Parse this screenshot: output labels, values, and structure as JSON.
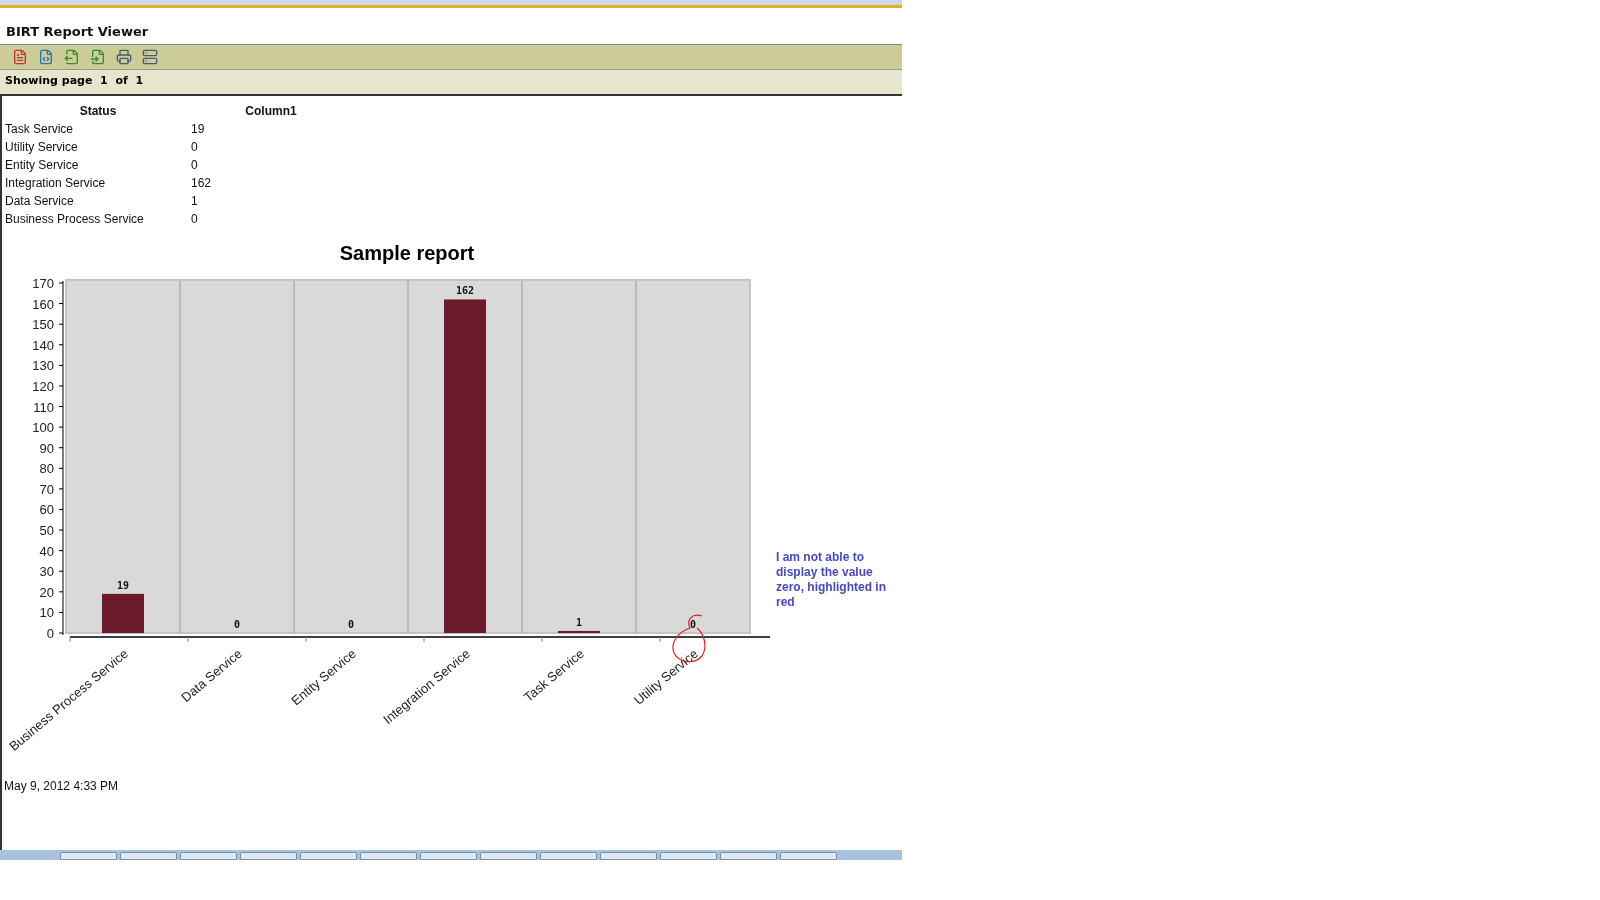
{
  "viewer": {
    "title": "BIRT Report Viewer",
    "page_info": "Showing page  1  of  1"
  },
  "table": {
    "columns": [
      "Status",
      "Column1"
    ],
    "rows": [
      [
        "Task Service",
        "19"
      ],
      [
        "Utility Service",
        "0"
      ],
      [
        "Entity Service",
        "0"
      ],
      [
        "Integration Service",
        "162"
      ],
      [
        "Data Service",
        "1"
      ],
      [
        "Business Process Service",
        "0"
      ]
    ]
  },
  "chart": {
    "chart_data": {
      "type": "bar",
      "title": "Sample report",
      "categories": [
        "Business Process Service",
        "Data Service",
        "Entity Service",
        "Integration Service",
        "Task Service",
        "Utility Service"
      ],
      "series": [
        {
          "color": "#6b1a2c",
          "values": [
            19,
            0,
            0,
            162,
            1,
            0
          ]
        }
      ],
      "ylim": [
        0,
        170
      ],
      "yticks": [
        0,
        10,
        20,
        30,
        40,
        50,
        60,
        70,
        80,
        90,
        100,
        110,
        120,
        130,
        140,
        150,
        160,
        170
      ],
      "data_labels": true
    }
  },
  "timestamp": "May 9, 2012 4:33 PM",
  "note": "I am not able to display the value zero, highlighted in red"
}
